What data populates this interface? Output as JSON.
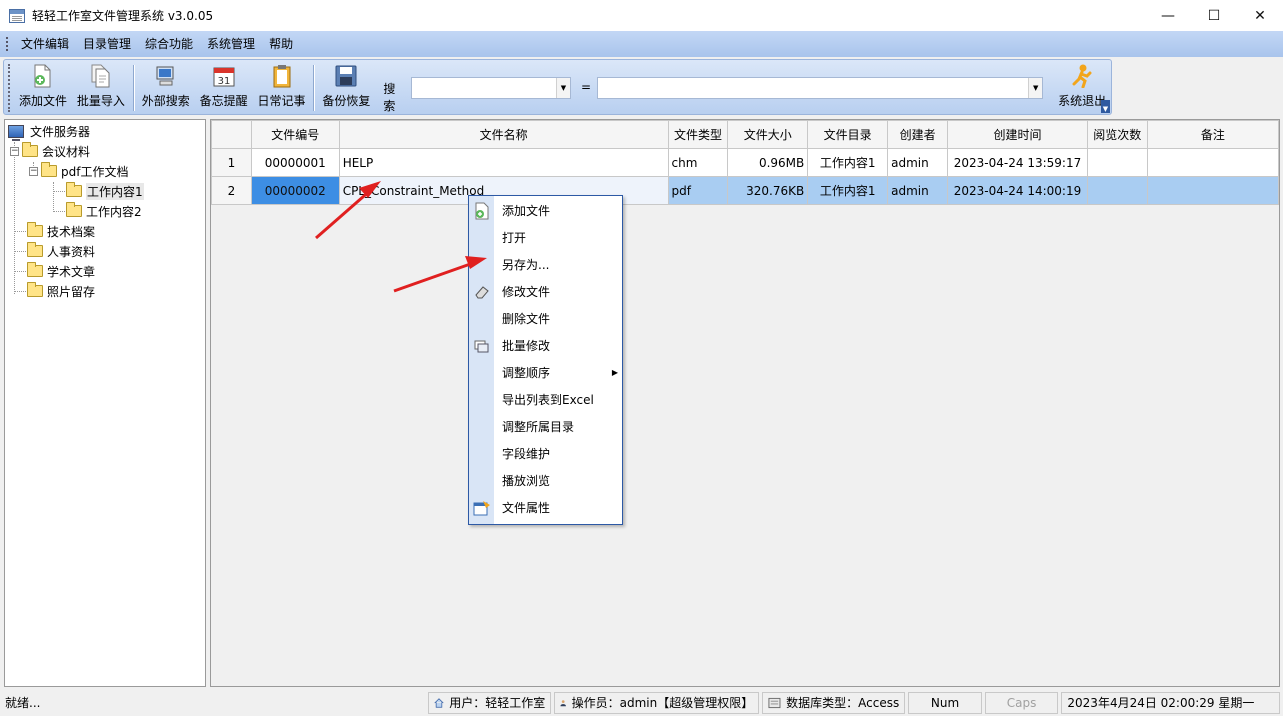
{
  "window": {
    "title": "轻轻工作室文件管理系统 v3.0.05",
    "controls": {
      "minimize": "—",
      "maximize": "☐",
      "close": "✕"
    }
  },
  "menubar": [
    "文件编辑",
    "目录管理",
    "综合功能",
    "系统管理",
    "帮助"
  ],
  "toolbar": {
    "add_file": "添加文件",
    "batch_import": "批量导入",
    "external_search": "外部搜索",
    "memo_reminder": "备忘提醒",
    "daily_notes": "日常记事",
    "backup_restore": "备份恢复",
    "search_label": "搜索",
    "search_field_value": "",
    "equals_label": "=",
    "search_value": "",
    "exit": "系统退出",
    "calendar_day": "31"
  },
  "tree": {
    "root": "文件服务器",
    "items": [
      {
        "label": "会议材料"
      },
      {
        "label": "pdf工作文档"
      },
      {
        "label": "工作内容1"
      },
      {
        "label": "工作内容2"
      },
      {
        "label": "技术档案"
      },
      {
        "label": "人事资料"
      },
      {
        "label": "学术文章"
      },
      {
        "label": "照片留存"
      }
    ]
  },
  "grid": {
    "columns": [
      "文件编号",
      "文件名称",
      "文件类型",
      "文件大小",
      "文件目录",
      "创建者",
      "创建时间",
      "阅览次数",
      "备注"
    ],
    "rows": [
      {
        "num": "1",
        "code": "00000001",
        "name": "HELP",
        "type": "chm",
        "size": "0.96MB",
        "dir": "工作内容1",
        "creator": "admin",
        "created": "2023-04-24 13:59:17",
        "views": "",
        "note": ""
      },
      {
        "num": "2",
        "code": "00000002",
        "name": "CPL_Constraint_Method",
        "type": "pdf",
        "size": "320.76KB",
        "dir": "工作内容1",
        "creator": "admin",
        "created": "2023-04-24 14:00:19",
        "views": "",
        "note": ""
      }
    ]
  },
  "context_menu": [
    {
      "label": "添加文件",
      "icon": "add-file-icon"
    },
    {
      "label": "打开",
      "icon": ""
    },
    {
      "label": "另存为...",
      "icon": ""
    },
    {
      "label": "修改文件",
      "icon": "eraser-icon"
    },
    {
      "label": "删除文件",
      "icon": ""
    },
    {
      "label": "批量修改",
      "icon": "batch-edit-icon"
    },
    {
      "label": "调整顺序",
      "icon": "",
      "submenu": true
    },
    {
      "label": "导出列表到Excel",
      "icon": ""
    },
    {
      "label": "调整所属目录",
      "icon": ""
    },
    {
      "label": "字段维护",
      "icon": ""
    },
    {
      "label": "播放浏览",
      "icon": ""
    },
    {
      "label": "文件属性",
      "icon": "file-properties-icon"
    }
  ],
  "statusbar": {
    "ready": "就绪...",
    "user": "用户：轻轻工作室",
    "operator": "操作员：admin【超级管理权限】",
    "db_type": "数据库类型：Access",
    "num": "Num",
    "caps": "Caps",
    "datetime": "2023年4月24日 02:00:29 星期一"
  },
  "colors": {
    "menubar": "#b4cdf0",
    "selection": "#3d8ee4",
    "selected_row": "#a9cdf2",
    "annotation_arrow": "#e02020"
  }
}
